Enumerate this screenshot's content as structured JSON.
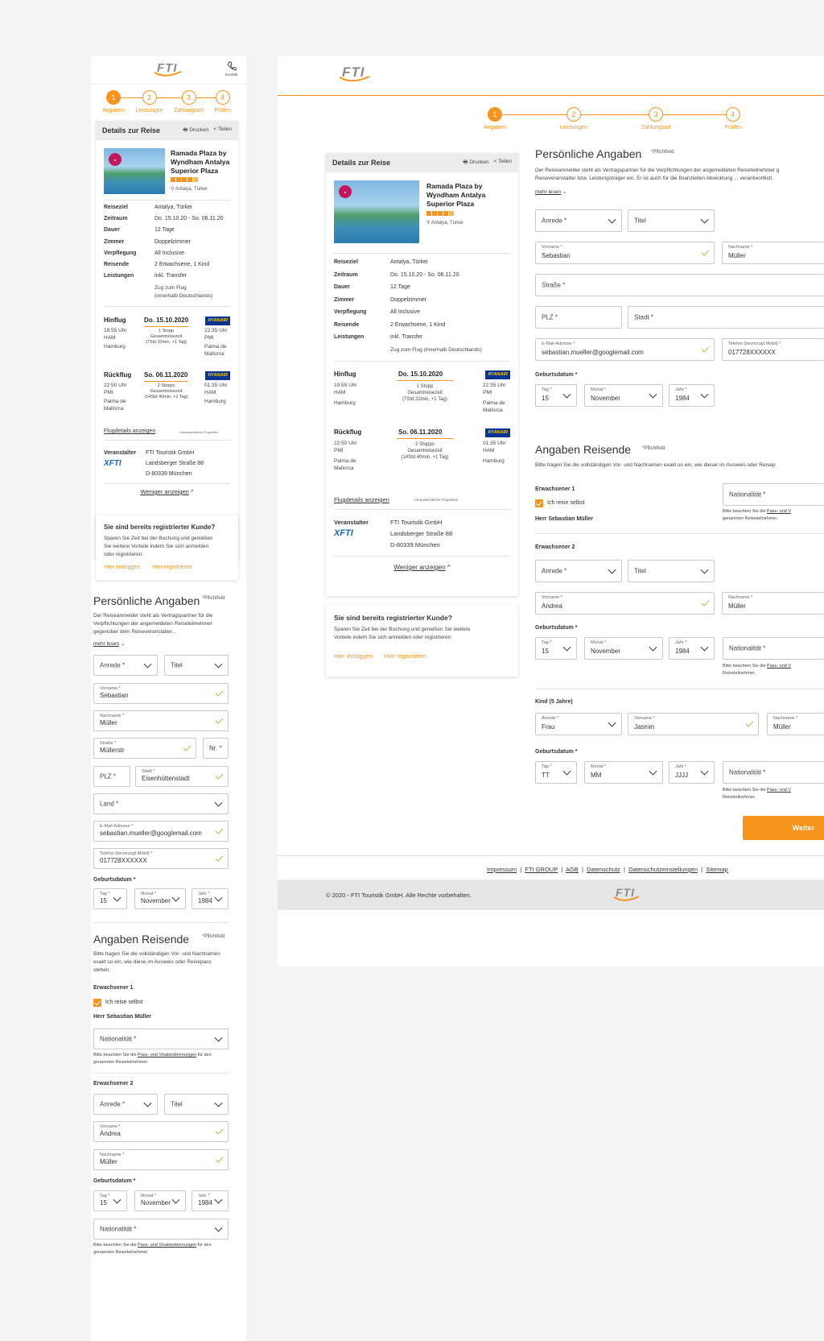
{
  "brand": {
    "logo": "FTI",
    "accent": "#f7941d",
    "xfti": "XFTI"
  },
  "header": {
    "contact_label": "Kontakt"
  },
  "steps": [
    {
      "num": "1",
      "label": "Angaben"
    },
    {
      "num": "2",
      "label": "Leistungen"
    },
    {
      "num": "3",
      "label": "Zahlungsart"
    },
    {
      "num": "4",
      "label": "Prüfen"
    }
  ],
  "trip": {
    "title": "Details zur Reise",
    "print": "Drucken",
    "share": "Teilen",
    "hotel_line1": "Ramada Plaza by",
    "hotel_line2": "Wyndham Antalya",
    "hotel_line3": "Superior Plaza",
    "location": "Antalya, Türkei",
    "rows": [
      {
        "k": "Reiseziel",
        "v": "Antalya, Türkei"
      },
      {
        "k": "Zeitraum",
        "v": "Do. 15.10.20 - So. 06.11.20"
      },
      {
        "k": "Dauer",
        "v": "12 Tage"
      },
      {
        "k": "Zimmer",
        "v": "Doppelzimmer"
      },
      {
        "k": "Verpflegung",
        "v": "All Inclusive"
      },
      {
        "k": "Reisende",
        "v": "2 Erwachsene, 1 Kind"
      },
      {
        "k": "Leistungen",
        "v": "inkl. Transfer"
      }
    ],
    "extra_m1": "Zug zum Flug",
    "extra_m2": "(innerhalb Deutschlands)",
    "extra_d": "Zug zum Flug (innerhalb Deutschlands)",
    "out": {
      "label": "Hinflug",
      "date": "Do. 15.10.2020",
      "dep_time": "19:55 Uhr",
      "dep_code": "HAM",
      "dep_city": "Hamburg",
      "stops": "1 Stopp",
      "total": "Gesamtreisezeit",
      "dur": "(7Std 32min, +1 Tag)",
      "arr_time": "22:35 Uhr",
      "arr_code": "PMI",
      "arr_city1": "Palma de",
      "arr_city2": "Mallorca",
      "airline": "RYANAIR"
    },
    "ret": {
      "label": "Rückflug",
      "date": "So. 06.11.2020",
      "dep_time": "22:50 Uhr",
      "dep_code": "PMI",
      "dep_city1": "Palma de",
      "dep_city2": "Mallorca",
      "stops": "2 Stopps",
      "total": "Gesamtreisezeit",
      "dur": "(14Std 40min, +1 Tag)",
      "arr_time": "01:35 Uhr",
      "arr_code": "HAM",
      "arr_city": "Hamburg",
      "airline": "RYANAIR"
    },
    "flight_link": "Flugdetails anzeigen",
    "flight_note": "Voraussichtliche Flugzeiten",
    "operator_label": "Veranstalter",
    "operator_name": "FTI Touristik GmbH",
    "operator_street": "Landsberger Straße 88",
    "operator_city": "D-80339 München",
    "less": "Weniger anzeigen"
  },
  "registered": {
    "title": "Sie sind bereits registrierter Kunde?",
    "text_m1": "Sparen Sie Zeit bei der Buchung und genießen",
    "text_m2": "Sie weitere Vorteile indem Sie sich anmelden",
    "text_m3": "oder registrieren:",
    "text_d1": "Sparen Sie Zeit bei der Buchung und genießen Sie weitere",
    "text_d2": "Vorteile indem Sie sich anmelden oder registrieren:",
    "login": "Hier einloggen",
    "register": "Hier registrieren"
  },
  "personal": {
    "title": "Persönliche Angaben",
    "required": "*Pflichtfeld",
    "intro_m1": "Der Reiseanmelder steht als Vertragspartner für die",
    "intro_m2": "Verpflichtungen der angemeldeten Reiseteilnehmer",
    "intro_m3": "gegenüber dem Reiseveranstalter...",
    "intro_d1": "Der Reiseanmelder steht als Vertragspartner für die Verpflichtungen der angemeldeten Reiseteilnehmer g",
    "intro_d2": "Reiseveranstalter bzw. Leistungsträger ein. Er ist auch für die finanziellen Abwicklung ... verantwortlich.",
    "more": "mehr lesen",
    "anrede": "Anrede *",
    "titel": "Titel",
    "vorname_label": "Vorname *",
    "vorname": "Sebastian",
    "nachname_label": "Nachname *",
    "nachname": "Müller",
    "strasse_label": "Straße *",
    "strasse": "Müllerstr",
    "nr": "Nr. *",
    "strasse_ph": "Straße *",
    "plz": "PLZ *",
    "stadt_label": "Stadt *",
    "stadt": "Eisenhüttenstadt",
    "stadt_ph": "Stadt *",
    "land": "Land *",
    "email_label": "E-Mail-Adresse *",
    "email": "sebastian.mueller@googlemail.com",
    "phone_label": "Telefon (bevorzugt Mobil) *",
    "phone": "017728XXXXXX",
    "dob": "Geburtsdatum *",
    "tag_label": "Tag *",
    "tag": "15",
    "monat_label": "Monat *",
    "monat": "November",
    "jahr_label": "Jahr *",
    "jahr": "1984"
  },
  "travellers": {
    "title": "Angaben Reisende",
    "required": "*Pflichtfeld",
    "intro_m1": "Bitte tragen Sie die vollständigen Vor- und Nachnamen",
    "intro_m2": "exakt so ein, wie diese im Ausweis oder Reisepass",
    "intro_m3": "stehen.",
    "intro_d": "Bitte tragen Sie die vollständigen Vor- und Nachnamen exakt so ein, wie dieser im Ausweis oder Reisep",
    "adult1": "Erwachsener 1",
    "self": "Ich reise selbst",
    "adult1_name": "Herr Sebastian Müller",
    "nationality": "Nationalität *",
    "pass_note_pre": "Bitte beachten Sie die ",
    "pass_link": "Pass- und Visabestimmungen",
    "pass_note_post": " für den",
    "pass_note_2": "genannten Reiseteilnehmer.",
    "pass_d_pre": "Bitte beachten Sie die ",
    "pass_d_link": "Pass- und V",
    "pass_d_2": "genannten Reiseteilnehmer.",
    "pass_d_2b": "Reiseteilnehmer.",
    "adult2": "Erwachsener 2",
    "anrede": "Anrede *",
    "titel": "Titel",
    "vorname_label": "Vorname *",
    "adult2_vorname": "Andrea",
    "nachname_label": "Nachname *",
    "adult2_nachname": "Müller",
    "dob": "Geburtsdatum *",
    "tag_label": "Tag *",
    "tag": "15",
    "monat_label": "Monat *",
    "monat": "November",
    "jahr_label": "Jahr *",
    "jahr": "1984",
    "child": "Kind (5 Jahre)",
    "anrede_label": "Anrede *",
    "child_anrede": "Frau",
    "child_vorname": "Jasmin",
    "child_nachname": "Müller",
    "tag_ph": "TT",
    "monat_ph": "MM",
    "jahr_ph": "JJJJ",
    "next": "Weiter"
  },
  "footer": {
    "links": [
      "Impressum",
      "FTI GROUP",
      "AGB",
      "Datenschutz",
      "Datenschutzeinstellungen",
      "Sitemap"
    ],
    "copyright": "©  2020  - FTI Touristik GmbH. Alle Rechte vorbehalten."
  }
}
